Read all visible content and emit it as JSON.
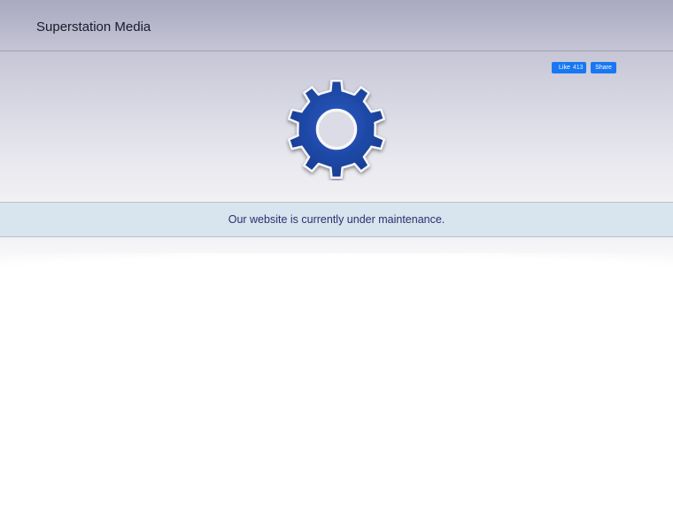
{
  "header": {
    "site_title": "Superstation Media"
  },
  "social": {
    "like_label": "Like",
    "like_count": "413",
    "share_label": "Share"
  },
  "main": {
    "gear_icon": "gear-icon",
    "notice": "Our website is currently under maintenance."
  },
  "colors": {
    "gear_fill": "#1c46a6",
    "facebook_blue": "#1877f2",
    "notice_bg": "#d8e4ee",
    "notice_text": "#2b2f6e"
  }
}
